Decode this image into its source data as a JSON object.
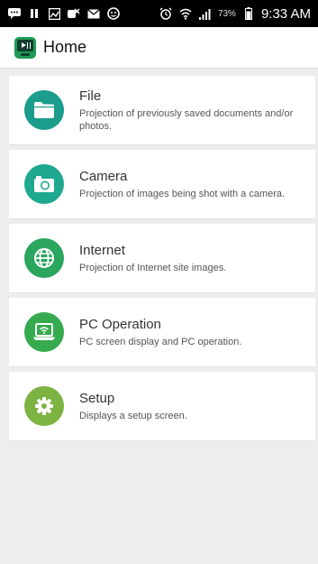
{
  "status_bar": {
    "battery_percent": "73%",
    "time": "9:33 AM",
    "left_icons": [
      "message-icon",
      "pause-icon",
      "gallery-icon",
      "missed-call-icon",
      "mail-icon",
      "face-icon"
    ],
    "right_icons": [
      "alarm-icon",
      "wifi-icon",
      "signal-icon",
      "battery-icon"
    ]
  },
  "app_bar": {
    "title": "Home",
    "logo_icon": "projector-app-icon"
  },
  "menu": {
    "items": [
      {
        "id": "file",
        "title": "File",
        "description": "Projection of previously saved documents and/or photos.",
        "icon": "folder-icon",
        "color": "#1b9c8c"
      },
      {
        "id": "camera",
        "title": "Camera",
        "description": "Projection of images being shot with a camera.",
        "icon": "camera-icon",
        "color": "#1ea98f"
      },
      {
        "id": "internet",
        "title": "Internet",
        "description": "Projection of Internet site images.",
        "icon": "globe-icon",
        "color": "#2aa65e"
      },
      {
        "id": "pc",
        "title": "PC Operation",
        "description": "PC screen display and PC operation.",
        "icon": "laptop-wifi-icon",
        "color": "#35aa4e"
      },
      {
        "id": "setup",
        "title": "Setup",
        "description": "Displays a setup screen.",
        "icon": "gear-icon",
        "color": "#7cb342"
      }
    ]
  },
  "colors": {
    "status_bar_bg": "#000000",
    "app_bar_bg": "#ffffff",
    "page_bg": "#eceeee",
    "card_bg": "#ffffff"
  }
}
